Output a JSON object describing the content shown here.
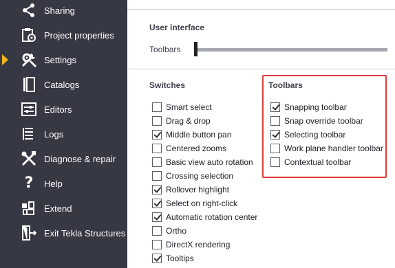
{
  "sidebar": {
    "items": [
      {
        "label": "Sharing",
        "icon": "share-icon",
        "active": false
      },
      {
        "label": "Project properties",
        "icon": "project-properties-icon",
        "active": false
      },
      {
        "label": "Settings",
        "icon": "settings-icon",
        "active": true
      },
      {
        "label": "Catalogs",
        "icon": "catalogs-icon",
        "active": false
      },
      {
        "label": "Editors",
        "icon": "editors-icon",
        "active": false
      },
      {
        "label": "Logs",
        "icon": "logs-icon",
        "active": false
      },
      {
        "label": "Diagnose & repair",
        "icon": "diagnose-repair-icon",
        "active": false
      },
      {
        "label": "Help",
        "icon": "help-icon",
        "active": false
      },
      {
        "label": "Extend",
        "icon": "extend-icon",
        "active": false
      },
      {
        "label": "Exit Tekla Structures",
        "icon": "exit-icon",
        "active": false
      }
    ]
  },
  "user_interface": {
    "title": "User interface",
    "slider_label": "Toolbars",
    "slider_value": 0
  },
  "switches": {
    "title": "Switches",
    "items": [
      {
        "label": "Smart select",
        "checked": false
      },
      {
        "label": "Drag & drop",
        "checked": false
      },
      {
        "label": "Middle button pan",
        "checked": true
      },
      {
        "label": "Centered zooms",
        "checked": false
      },
      {
        "label": "Basic view auto rotation",
        "checked": false
      },
      {
        "label": "Crossing selection",
        "checked": false
      },
      {
        "label": "Rollover highlight",
        "checked": true
      },
      {
        "label": "Select on right-click",
        "checked": true
      },
      {
        "label": "Automatic rotation center",
        "checked": true
      },
      {
        "label": "Ortho",
        "checked": false
      },
      {
        "label": "DirectX rendering",
        "checked": false
      },
      {
        "label": "Tooltips",
        "checked": true
      }
    ]
  },
  "toolbars": {
    "title": "Toolbars",
    "items": [
      {
        "label": "Snapping toolbar",
        "checked": true
      },
      {
        "label": "Snap override toolbar",
        "checked": false
      },
      {
        "label": "Selecting toolbar",
        "checked": true
      },
      {
        "label": "Work plane handler toolbar",
        "checked": false
      },
      {
        "label": "Contextual toolbar",
        "checked": false
      }
    ]
  },
  "colors": {
    "sidebar_bg": "#363844",
    "active_marker": "#f2b51d",
    "highlight_border": "#e03c3c"
  }
}
